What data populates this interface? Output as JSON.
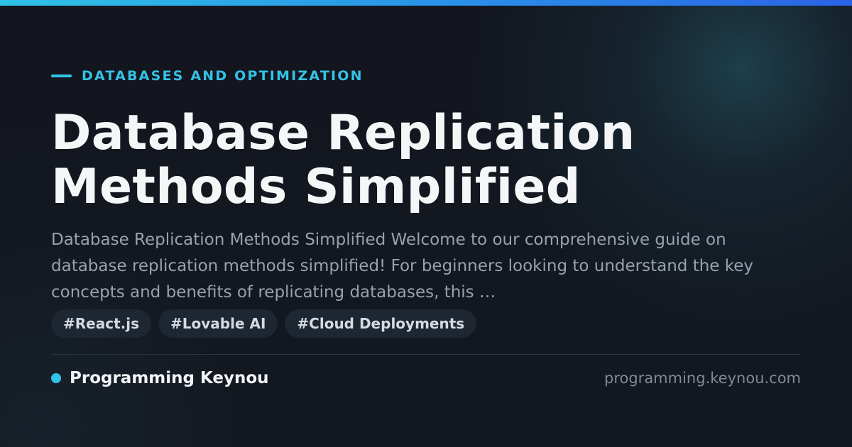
{
  "category": "DATABASES AND OPTIMIZATION",
  "title": {
    "line1": "Database Replication",
    "line2": "Methods Simplified"
  },
  "description": "Database Replication Methods Simplified Welcome to our comprehensive guide on database replication methods simplified! For beginners looking to understand the key concepts and benefits of replicating databases, this …",
  "tags": [
    "#React.js",
    "#Lovable AI",
    "#Cloud Deployments"
  ],
  "footer": {
    "brand": "Programming Keynou",
    "url": "programming.keynou.com"
  },
  "colors": {
    "accent": "#31c4ea",
    "background": "#13161e",
    "title_text": "#f4f6f8",
    "body_text": "#98a1ad",
    "tag_background": "#1d2631"
  },
  "icons": {
    "kicker": "accent-line-icon",
    "brand": "brand-dot-icon"
  }
}
